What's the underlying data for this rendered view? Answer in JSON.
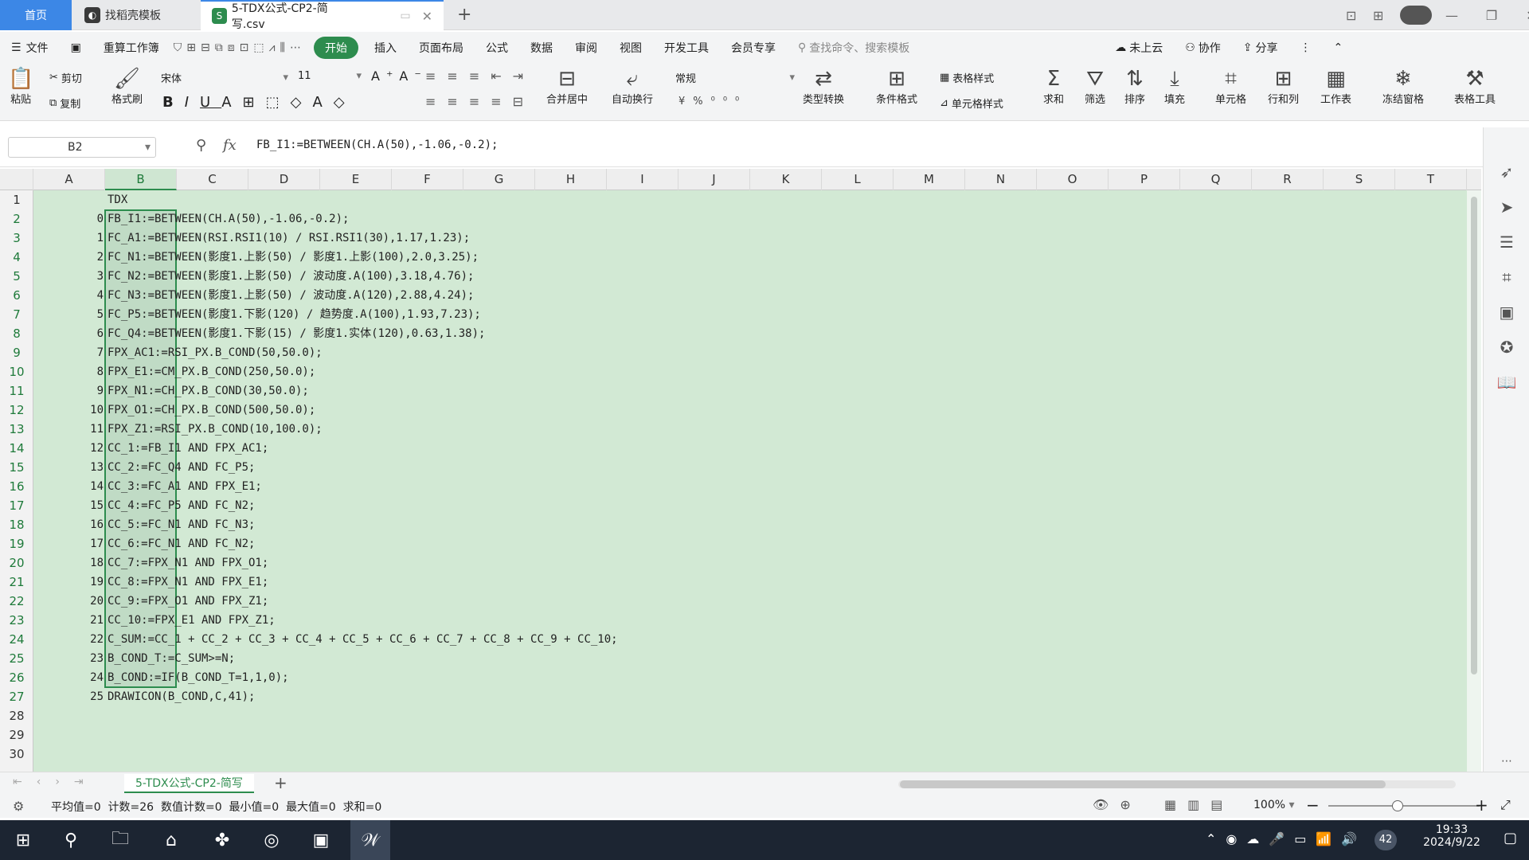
{
  "titlebar": {
    "home_tab": "首页",
    "template_tab": "找稻壳模板",
    "file_tab": "5-TDX公式-CP2-简写.csv"
  },
  "menu": {
    "file": "文件",
    "recalc": "重算工作簿",
    "tabs": [
      "开始",
      "插入",
      "页面布局",
      "公式",
      "数据",
      "审阅",
      "视图",
      "开发工具",
      "会员专享"
    ],
    "search_placeholder": "查找命令、搜索模板",
    "cloud": "未上云",
    "collab": "协作",
    "share": "分享"
  },
  "ribbon": {
    "paste": "粘贴",
    "cut": "剪切",
    "copy": "复制",
    "format_painter": "格式刷",
    "font_name": "宋体",
    "font_size": "11",
    "merge_center": "合并居中",
    "wrap": "自动换行",
    "number_format": "常规",
    "type_convert": "类型转换",
    "cond_format": "条件格式",
    "table_style": "表格样式",
    "cell_style": "单元格样式",
    "sum": "求和",
    "filter": "筛选",
    "sort": "排序",
    "fill": "填充",
    "cell": "单元格",
    "row_col": "行和列",
    "worksheet": "工作表",
    "freeze": "冻结窗格",
    "table_tools": "表格工具"
  },
  "formula_bar": {
    "cell_ref": "B2",
    "formula": "FB_I1:=BETWEEN(CH.A(50),-1.06,-0.2);"
  },
  "columns": [
    "A",
    "B",
    "C",
    "D",
    "E",
    "F",
    "G",
    "H",
    "I",
    "J",
    "K",
    "L",
    "M",
    "N",
    "O",
    "P",
    "Q",
    "R",
    "S",
    "T"
  ],
  "row_numbers": [
    "1",
    "2",
    "3",
    "4",
    "5",
    "6",
    "7",
    "8",
    "9",
    "10",
    "11",
    "12",
    "13",
    "14",
    "15",
    "16",
    "17",
    "18",
    "19",
    "20",
    "21",
    "22",
    "23",
    "24",
    "25",
    "26",
    "27",
    "28",
    "29",
    "30"
  ],
  "rows": [
    {
      "a": "",
      "b": "TDX"
    },
    {
      "a": "0",
      "b": "FB_I1:=BETWEEN(CH.A(50),-1.06,-0.2);"
    },
    {
      "a": "1",
      "b": "FC_A1:=BETWEEN(RSI.RSI1(10) / RSI.RSI1(30),1.17,1.23);"
    },
    {
      "a": "2",
      "b": "FC_N1:=BETWEEN(影度1.上影(50) / 影度1.上影(100),2.0,3.25);"
    },
    {
      "a": "3",
      "b": "FC_N2:=BETWEEN(影度1.上影(50) / 波动度.A(100),3.18,4.76);"
    },
    {
      "a": "4",
      "b": "FC_N3:=BETWEEN(影度1.上影(50) / 波动度.A(120),2.88,4.24);"
    },
    {
      "a": "5",
      "b": "FC_P5:=BETWEEN(影度1.下影(120) / 趋势度.A(100),1.93,7.23);"
    },
    {
      "a": "6",
      "b": "FC_Q4:=BETWEEN(影度1.下影(15) / 影度1.实体(120),0.63,1.38);"
    },
    {
      "a": "7",
      "b": "FPX_AC1:=RSI_PX.B_COND(50,50.0);"
    },
    {
      "a": "8",
      "b": "FPX_E1:=CM_PX.B_COND(250,50.0);"
    },
    {
      "a": "9",
      "b": "FPX_N1:=CH_PX.B_COND(30,50.0);"
    },
    {
      "a": "10",
      "b": "FPX_O1:=CH_PX.B_COND(500,50.0);"
    },
    {
      "a": "11",
      "b": "FPX_Z1:=RSI_PX.B_COND(10,100.0);"
    },
    {
      "a": "12",
      "b": "CC_1:=FB_I1 AND FPX_AC1;"
    },
    {
      "a": "13",
      "b": "CC_2:=FC_Q4 AND FC_P5;"
    },
    {
      "a": "14",
      "b": "CC_3:=FC_A1 AND FPX_E1;"
    },
    {
      "a": "15",
      "b": "CC_4:=FC_P5 AND FC_N2;"
    },
    {
      "a": "16",
      "b": "CC_5:=FC_N1 AND FC_N3;"
    },
    {
      "a": "17",
      "b": "CC_6:=FC_N1 AND FC_N2;"
    },
    {
      "a": "18",
      "b": "CC_7:=FPX_N1 AND FPX_O1;"
    },
    {
      "a": "19",
      "b": "CC_8:=FPX_N1 AND FPX_E1;"
    },
    {
      "a": "20",
      "b": "CC_9:=FPX_O1 AND FPX_Z1;"
    },
    {
      "a": "21",
      "b": "CC_10:=FPX_E1 AND FPX_Z1;"
    },
    {
      "a": "22",
      "b": "C_SUM:=CC_1 + CC_2 + CC_3 + CC_4 + CC_5 + CC_6 + CC_7 + CC_8 + CC_9 + CC_10;"
    },
    {
      "a": "23",
      "b": "B_COND_T:=C_SUM>=N;"
    },
    {
      "a": "24",
      "b": "B_COND:=IF(B_COND_T=1,1,0);"
    },
    {
      "a": "25",
      "b": "DRAWICON(B_COND,C,41);"
    }
  ],
  "sheet": {
    "name": "5-TDX公式-CP2-简写"
  },
  "status": {
    "text": "平均值=0  计数=26  数值计数=0  最小值=0  最大值=0  求和=0",
    "zoom": "100%"
  },
  "taskbar": {
    "time": "19:33",
    "date": "2024/9/22",
    "badge": "42"
  },
  "colors": {
    "accent": "#2d8c4e",
    "grid_bg": "#d2e9d4",
    "home_tab": "#3c87e6"
  }
}
